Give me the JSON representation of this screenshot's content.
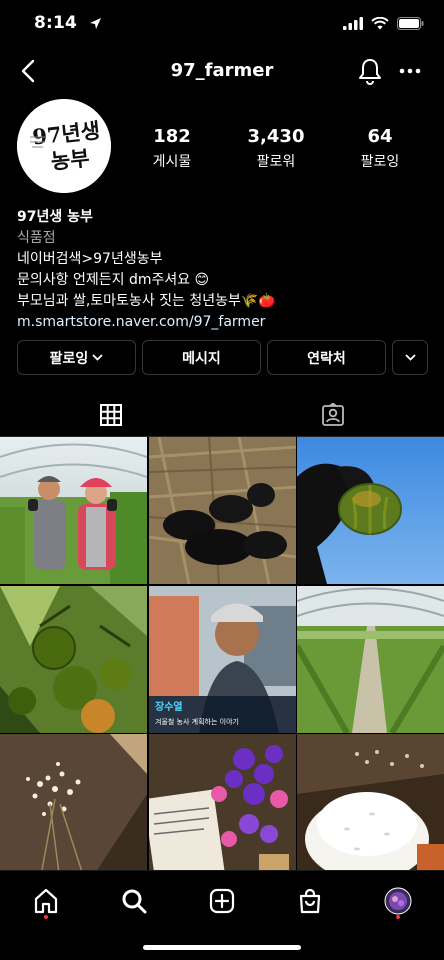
{
  "status_bar": {
    "time": "8:14"
  },
  "header": {
    "username": "97_farmer"
  },
  "avatar": {
    "text_top": "97년생",
    "text_bottom": "농부"
  },
  "stats": [
    {
      "value": "182",
      "label": "게시물"
    },
    {
      "value": "3,430",
      "label": "팔로워"
    },
    {
      "value": "64",
      "label": "팔로잉"
    }
  ],
  "bio": {
    "name": "97년생 농부",
    "category": "식품점",
    "line1": "네이버검색>97년생농부",
    "line2": "문의사항 언제든지 dm주셔요 😊",
    "line3": "부모님과 쌀,토마토농사 짓는 청년농부🌾🍅",
    "link": "m.smartstore.naver.com/97_farmer"
  },
  "actions": {
    "follow": "팔로잉",
    "message": "메시지",
    "contact": "연락처"
  },
  "grid_posts": [
    "farmers-in-greenhouse",
    "black-puppies-on-straw",
    "hand-holding-tomato",
    "green-tomatoes-on-vine",
    "farmer-tv-interview",
    "greenhouse-rows",
    "babys-breath-flowers",
    "purple-flower-bouquet",
    "rice-bowl-with-flowers"
  ],
  "tv_caption": {
    "name": "장수열",
    "subtitle": "겨울철 농사 계획하는 이야기"
  },
  "colors": {
    "background": "#000000",
    "border": "#363636",
    "category": "#a8a8a8",
    "notify": "#ff3040"
  },
  "icons": {
    "back": "chevron-left-icon",
    "bell": "bell-icon",
    "more": "more-horizontal-icon",
    "grid": "grid-icon",
    "tagged": "tagged-icon",
    "home": "home-icon",
    "search": "search-icon",
    "create": "plus-square-icon",
    "shop": "shopping-bag-icon",
    "profile": "profile-avatar-icon"
  }
}
